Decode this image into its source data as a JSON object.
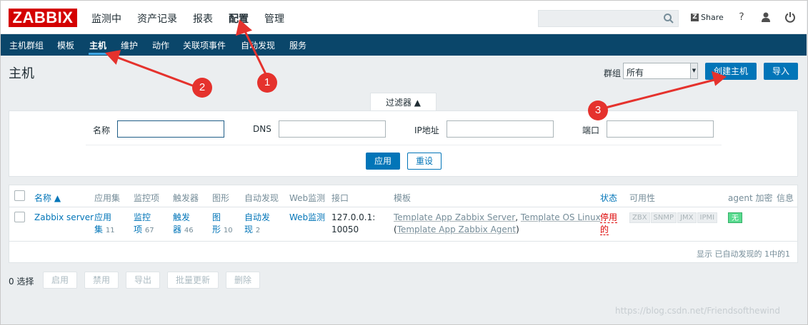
{
  "topbar": {
    "logo": "ZABBIX",
    "menu": [
      "监测中",
      "资产记录",
      "报表",
      "配置",
      "管理"
    ],
    "active_menu": "配置",
    "search": {
      "placeholder": "",
      "value": ""
    },
    "share_label": "Share",
    "share_badge": "Z",
    "help_label": "?",
    "icons": [
      "search-icon",
      "user-icon",
      "power-icon"
    ]
  },
  "subnav": {
    "items": [
      "主机群组",
      "模板",
      "主机",
      "维护",
      "动作",
      "关联项事件",
      "自动发现",
      "服务"
    ],
    "active": "主机"
  },
  "header": {
    "title": "主机",
    "group_label": "群组",
    "group_value": "所有",
    "create_button": "创建主机",
    "import_button": "导入"
  },
  "filter": {
    "tab_label": "过滤器 ▲",
    "name_label": "名称",
    "dns_label": "DNS",
    "ip_label": "IP地址",
    "port_label": "端口",
    "apply_button": "应用",
    "reset_button": "重设"
  },
  "table": {
    "headers": [
      "名称 ▲",
      "应用集",
      "监控项",
      "触发器",
      "图形",
      "自动发现",
      "Web监测",
      "接口",
      "模板",
      "状态",
      "可用性",
      "agent 加密",
      "信息"
    ],
    "rows": [
      {
        "name": "Zabbix server",
        "applications": [
          "应用",
          "集"
        ],
        "applications_count": "11",
        "items": [
          "监控",
          "项"
        ],
        "items_count": "67",
        "triggers": [
          "触发",
          "器"
        ],
        "triggers_count": "46",
        "graphs": [
          "图",
          "形"
        ],
        "graphs_count": "10",
        "discovery": [
          "自动发",
          "现"
        ],
        "discovery_count": "2",
        "web": "Web监测",
        "interface": [
          "127.0.0.1:",
          "10050"
        ],
        "templates": [
          "Template App Zabbix Server",
          ", ",
          "Template OS Linux",
          "(",
          "Template App Zabbix Agent",
          ")"
        ],
        "status": [
          "停用",
          "的"
        ],
        "availability": [
          "ZBX",
          "SNMP",
          "JMX",
          "IPMI"
        ],
        "encryption": "无"
      }
    ],
    "footer": "显示 已自动发现的 1中的1"
  },
  "actions": {
    "selected": "0 选择",
    "buttons": [
      "启用",
      "禁用",
      "导出",
      "批量更新",
      "删除"
    ]
  },
  "annotations": {
    "markers": [
      "1",
      "2",
      "3"
    ],
    "color": "#e5322d"
  },
  "watermark": "https://blog.csdn.net/Friendsofthewind",
  "colors": {
    "brand": "#d40000",
    "nav": "#0a466a",
    "accent": "#0275b8",
    "danger": "#dc0000",
    "ok": "#59db8f"
  }
}
